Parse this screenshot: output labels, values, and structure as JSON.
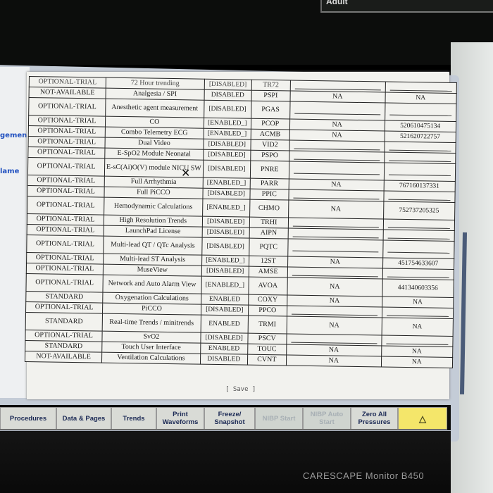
{
  "top_panel_label": "Adult",
  "left_labels": [
    "gement",
    "lame"
  ],
  "cut_row": {
    "c1": "OPTIONAL-TRIAL",
    "c2": "72 Hour trending",
    "c3": "[DISABLED]",
    "c4": "TR72"
  },
  "rows": [
    {
      "status": "NOT-AVAILABLE",
      "name": "Analgesia / SPI",
      "state": "DISABLED",
      "code": "PSPI",
      "trial": "NA",
      "key": "NA",
      "tall": false
    },
    {
      "status": "OPTIONAL-TRIAL",
      "name": "Anesthetic agent measurement",
      "state": "[DISABLED]",
      "code": "PGAS",
      "trial": "",
      "key": "",
      "tall": true
    },
    {
      "status": "OPTIONAL-TRIAL",
      "name": "CO",
      "state": "[ENABLED_]",
      "code": "PCOP",
      "trial": "NA",
      "key": "520610475134",
      "tall": false
    },
    {
      "status": "OPTIONAL-TRIAL",
      "name": "Combo Telemetry ECG",
      "state": "[ENABLED_]",
      "code": "ACMB",
      "trial": "NA",
      "key": "521620722757",
      "tall": false
    },
    {
      "status": "OPTIONAL-TRIAL",
      "name": "Dual Video",
      "state": "[DISABLED]",
      "code": "VID2",
      "trial": "",
      "key": "",
      "tall": false
    },
    {
      "status": "OPTIONAL-TRIAL",
      "name": "E-SpO2 Module Neonatal",
      "state": "[DISABLED]",
      "code": "PSPO",
      "trial": "",
      "key": "",
      "tall": false
    },
    {
      "status": "OPTIONAL-TRIAL",
      "name": "E-sC(Ai)O(V) module NICU SW",
      "state": "[DISABLED]",
      "code": "PNRE",
      "trial": "",
      "key": "",
      "tall": true
    },
    {
      "status": "OPTIONAL-TRIAL",
      "name": "Full Arrhythmia",
      "state": "[ENABLED_]",
      "code": "PARR",
      "trial": "NA",
      "key": "767160137331",
      "tall": false
    },
    {
      "status": "OPTIONAL-TRIAL",
      "name": "Full PiCCO",
      "state": "[DISABLED]",
      "code": "PPIC",
      "trial": "",
      "key": "",
      "tall": false
    },
    {
      "status": "OPTIONAL-TRIAL",
      "name": "Hemodynamic Calculations",
      "state": "[ENABLED_]",
      "code": "CHMO",
      "trial": "NA",
      "key": "752737205325",
      "tall": true
    },
    {
      "status": "OPTIONAL-TRIAL",
      "name": "High Resolution Trends",
      "state": "[DISABLED]",
      "code": "TRHI",
      "trial": "",
      "key": "",
      "tall": false
    },
    {
      "status": "OPTIONAL-TRIAL",
      "name": "LaunchPad License",
      "state": "[DISABLED]",
      "code": "AIPN",
      "trial": "",
      "key": "",
      "tall": false
    },
    {
      "status": "OPTIONAL-TRIAL",
      "name": "Multi-lead QT / QTc Analysis",
      "state": "[DISABLED]",
      "code": "PQTC",
      "trial": "",
      "key": "",
      "tall": true
    },
    {
      "status": "OPTIONAL-TRIAL",
      "name": "Multi-lead ST Analysis",
      "state": "[ENABLED_]",
      "code": "12ST",
      "trial": "NA",
      "key": "451754633607",
      "tall": false
    },
    {
      "status": "OPTIONAL-TRIAL",
      "name": "MuseView",
      "state": "[DISABLED]",
      "code": "AMSE",
      "trial": "",
      "key": "",
      "tall": false
    },
    {
      "status": "OPTIONAL-TRIAL",
      "name": "Network and Auto Alarm View",
      "state": "[ENABLED_]",
      "code": "AVOA",
      "trial": "NA",
      "key": "441340603356",
      "tall": true
    },
    {
      "status": "STANDARD",
      "name": "Oxygenation Calculations",
      "state": "ENABLED",
      "code": "COXY",
      "trial": "NA",
      "key": "NA",
      "tall": false
    },
    {
      "status": "OPTIONAL-TRIAL",
      "name": "PiCCO",
      "state": "[DISABLED]",
      "code": "PPCO",
      "trial": "",
      "key": "",
      "tall": false
    },
    {
      "status": "STANDARD",
      "name": "Real-time Trends / minitrends",
      "state": "ENABLED",
      "code": "TRMI",
      "trial": "NA",
      "key": "NA",
      "tall": true
    },
    {
      "status": "OPTIONAL-TRIAL",
      "name": "SvO2",
      "state": "[DISABLED]",
      "code": "PSCV",
      "trial": "",
      "key": "",
      "tall": false
    },
    {
      "status": "STANDARD",
      "name": "Touch User Interface",
      "state": "ENABLED",
      "code": "TOUC",
      "trial": "NA",
      "key": "NA",
      "tall": false
    },
    {
      "status": "NOT-AVAILABLE",
      "name": "Ventilation Calculations",
      "state": "DISABLED",
      "code": "CVNT",
      "trial": "NA",
      "key": "NA",
      "tall": false
    }
  ],
  "save_label": "[ Save ]",
  "keys": [
    {
      "label": "Procedures",
      "style": "normal"
    },
    {
      "label": "Data & Pages",
      "style": "normal"
    },
    {
      "label": "Trends",
      "style": "normal"
    },
    {
      "label": "Print Waveforms",
      "style": "normal"
    },
    {
      "label": "Freeze/ Snapshot",
      "style": "normal"
    },
    {
      "label": "NIBP Start",
      "style": "dim"
    },
    {
      "label": "NIBP Auto Start",
      "style": "dim"
    },
    {
      "label": "Zero All Pressures",
      "style": "normal"
    },
    {
      "label": "△",
      "style": "yellow"
    }
  ],
  "brand": "CARESCAPE Monitor B450"
}
